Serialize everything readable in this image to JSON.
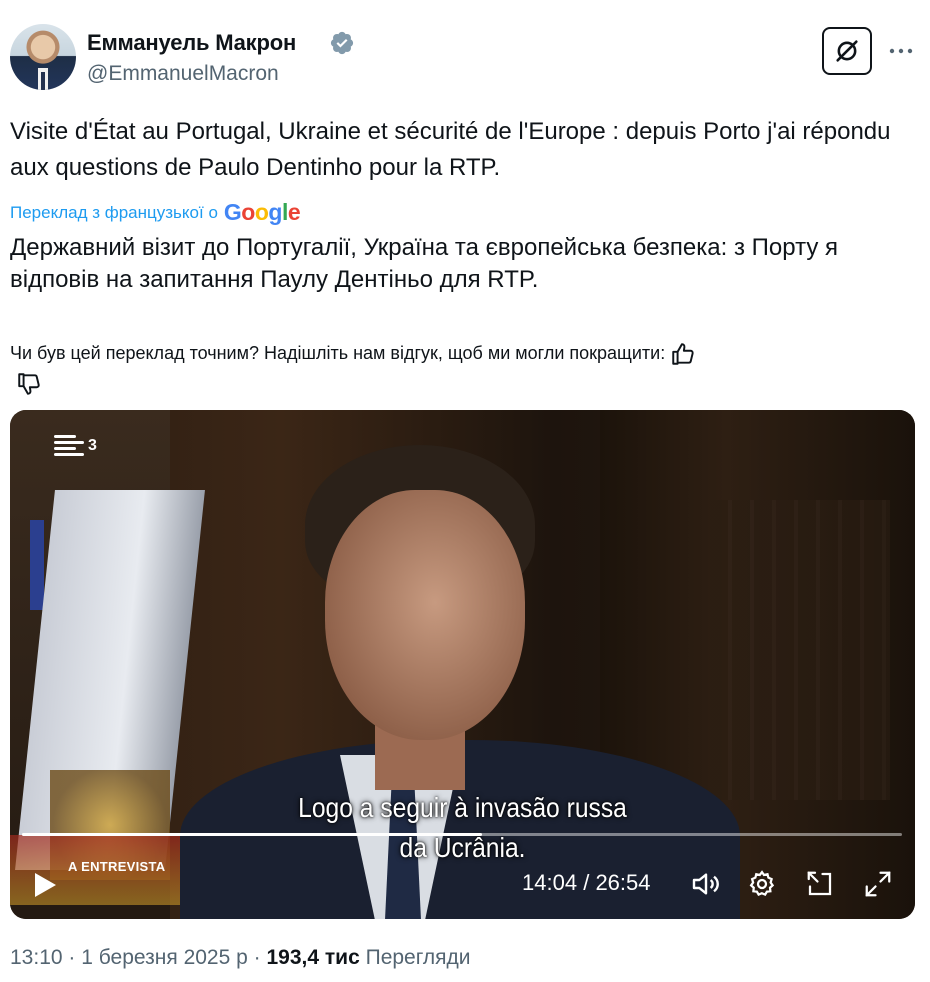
{
  "author": {
    "name": "Еммануель Макрон",
    "handle": "@EmmanuelMacron"
  },
  "tweet": {
    "text": "Visite d'État au Portugal, Ukraine et sécurité de l'Europe : depuis Porto j'ai répondu aux questions de Paulo Dentinho pour la RTP.",
    "translate_label": "Переклад з французької о",
    "google_letters": [
      "G",
      "o",
      "o",
      "g",
      "l",
      "e"
    ],
    "translated_text": "Державний візит до Португалії, Україна та європейська безпека: з Порту я відповів на запитання Паулу Дентіньо для RTP.",
    "feedback_prompt": "Чи був цей переклад точним? Надішліть нам відгук, щоб ми могли покращити:"
  },
  "video": {
    "channel_label": "3",
    "subtitle_line1": "Logo a seguir à invasão russa",
    "subtitle_line2": "da Ucrânia.",
    "lower_third": "A ENTREVISTA",
    "current_time": "14:04",
    "separator": "/",
    "duration": "26:54",
    "progress_fraction": 0.523
  },
  "footer": {
    "time": "13:10",
    "date": "1 березня 2025 р",
    "dot": "·",
    "views_count": "193,4 тис",
    "views_label": "Перегляди"
  },
  "icons": {
    "verified": "verified-badge-icon",
    "grok": "grok-icon",
    "more": "more-icon",
    "thumbs_up": "thumbs-up-icon",
    "thumbs_down": "thumbs-down-icon",
    "play": "play-icon",
    "volume": "volume-icon",
    "settings": "gear-icon",
    "pip": "picture-in-picture-icon",
    "fullscreen": "fullscreen-icon"
  },
  "colors": {
    "link": "#1d9bf0",
    "secondary_text": "#536471",
    "primary_text": "#0f1419"
  }
}
